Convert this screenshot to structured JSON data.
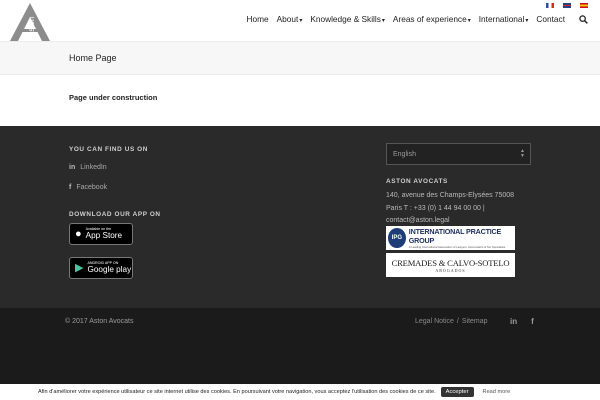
{
  "header": {
    "logo_text": "Aston",
    "nav": [
      {
        "label": "Home",
        "dropdown": false
      },
      {
        "label": "About",
        "dropdown": true
      },
      {
        "label": "Knowledge & Skills",
        "dropdown": true
      },
      {
        "label": "Areas of experience",
        "dropdown": true
      },
      {
        "label": "International",
        "dropdown": true
      },
      {
        "label": "Contact",
        "dropdown": false
      }
    ],
    "flags": [
      "fr-flag-icon",
      "uk-flag-icon",
      "es-flag-icon"
    ],
    "search_icon": "search-icon"
  },
  "page": {
    "title": "Home Page",
    "body": "Page under construction"
  },
  "footer": {
    "find_heading": "YOU CAN FIND US ON",
    "linkedin": "LinkedIn",
    "facebook": "Facebook",
    "app_heading": "DOWNLOAD OUR APP ON",
    "appstore_small": "Available on the",
    "appstore_big": "App Store",
    "googleplay_small": "ANDROID APP ON",
    "googleplay_big": "Google play",
    "language_selected": "English",
    "company_heading": "ASTON AVOCATS",
    "address_line1": "140, avenue des Champs-Elysées 75008",
    "address_line2": "Paris T : +33 (0) 1 44 94 00 00 |",
    "address_line3": "contact@aston.legal",
    "ipg_mark": "IPG",
    "ipg_title": "INTERNATIONAL PRACTICE GROUP",
    "ipg_subtitle": "A Leading International Association of Lawyers, Accountants & Tax Specialists",
    "cremades_title": "CREMADES & CALVO-SOTELO",
    "cremades_subtitle": "ABOGADOS"
  },
  "bottom": {
    "copyright": "© 2017 Aston Avocats",
    "legal_notice": "Legal Notice",
    "separator": "/",
    "sitemap": "Sitemap"
  },
  "cookie": {
    "message": "Afin d'améliorer votre expérience utilisateur ce site internet utilise des cookies. En poursuivant votre navigation, vous acceptez l'utilisation des cookies de ce site.",
    "accept": "Accepter",
    "more": "Read more"
  },
  "colors": {
    "footer_bg": "#2a2a2a",
    "bottombar_bg": "#1b1b1b",
    "titlebar_bg": "#f7f7f7"
  }
}
